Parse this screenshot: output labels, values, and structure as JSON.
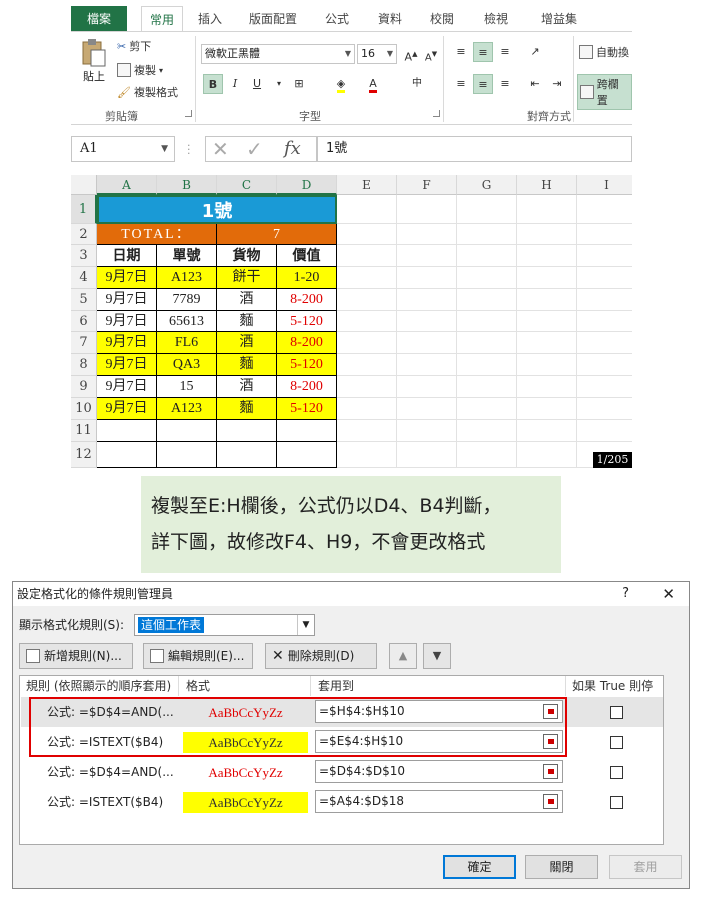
{
  "ribbon": {
    "tabs": [
      "檔案",
      "常用",
      "插入",
      "版面配置",
      "公式",
      "資料",
      "校閱",
      "檢視",
      "增益集"
    ],
    "active_tab": "常用",
    "clipboard": {
      "paste": "貼上",
      "cut": "剪下",
      "copy": "複製",
      "format_painter": "複製格式",
      "group": "剪貼簿"
    },
    "font": {
      "name": "微軟正黑體",
      "size": "16",
      "bold": "B",
      "italic": "I",
      "underline": "U",
      "group": "字型"
    },
    "alignment": {
      "wrap": "自動換",
      "merge": "跨欄置",
      "group": "對齊方式"
    }
  },
  "formula_bar": {
    "name_box": "A1",
    "content": "1號"
  },
  "sheet": {
    "columns": [
      "A",
      "B",
      "C",
      "D",
      "E",
      "F",
      "G",
      "H",
      "I"
    ],
    "rows": [
      "1",
      "2",
      "3",
      "4",
      "5",
      "6",
      "7",
      "8",
      "9",
      "10",
      "11",
      "12"
    ],
    "title": "1號",
    "total_label": "TOTAL：",
    "total_value": "7",
    "headers": [
      "日期",
      "單號",
      "貨物",
      "價值"
    ],
    "data": [
      [
        "9月7日",
        "A123",
        "餅干",
        "1-20"
      ],
      [
        "9月7日",
        "7789",
        "酒",
        "8-200"
      ],
      [
        "9月7日",
        "65613",
        "麵",
        "5-120"
      ],
      [
        "9月7日",
        "FL6",
        "酒",
        "8-200"
      ],
      [
        "9月7日",
        "QA3",
        "麵",
        "5-120"
      ],
      [
        "9月7日",
        "15",
        "酒",
        "8-200"
      ],
      [
        "9月7日",
        "A123",
        "麵",
        "5-120"
      ]
    ],
    "page_indicator": "1/205",
    "colors": {
      "title_bg": "#1a9ad6",
      "total_bg": "#e26b0a",
      "highlight": "#ffff00",
      "red_text": "#e00000"
    }
  },
  "note": {
    "line1": "複製至E:H欄後，公式仍以D4、B4判斷，",
    "line2": "詳下圖，故修改F4、H9，不會更改格式"
  },
  "dialog": {
    "title": "設定格式化的條件規則管理員",
    "help": "?",
    "close": "✕",
    "show_label": "顯示格式化規則(S):",
    "show_value": "這個工作表",
    "buttons": {
      "new": "新增規則(N)...",
      "edit": "編輯規則(E)...",
      "delete": "刪除規則(D)"
    },
    "columns": {
      "rule": "規則 (依照顯示的順序套用)",
      "format": "格式",
      "applies": "套用到",
      "stop": "如果 True 則停止"
    },
    "rules": [
      {
        "rule": "公式: =$D$4=AND(...",
        "preview": "AaBbCcYyZz",
        "applies": "=$H$4:$H$10"
      },
      {
        "rule": "公式: =ISTEXT($B4)",
        "preview": "AaBbCcYyZz",
        "applies": "=$E$4:$H$10"
      },
      {
        "rule": "公式: =$D$4=AND(...",
        "preview": "AaBbCcYyZz",
        "applies": "=$D$4:$D$10"
      },
      {
        "rule": "公式: =ISTEXT($B4)",
        "preview": "AaBbCcYyZz",
        "applies": "=$A$4:$D$18"
      }
    ],
    "ok": "確定",
    "close_btn": "關閉",
    "apply": "套用"
  }
}
